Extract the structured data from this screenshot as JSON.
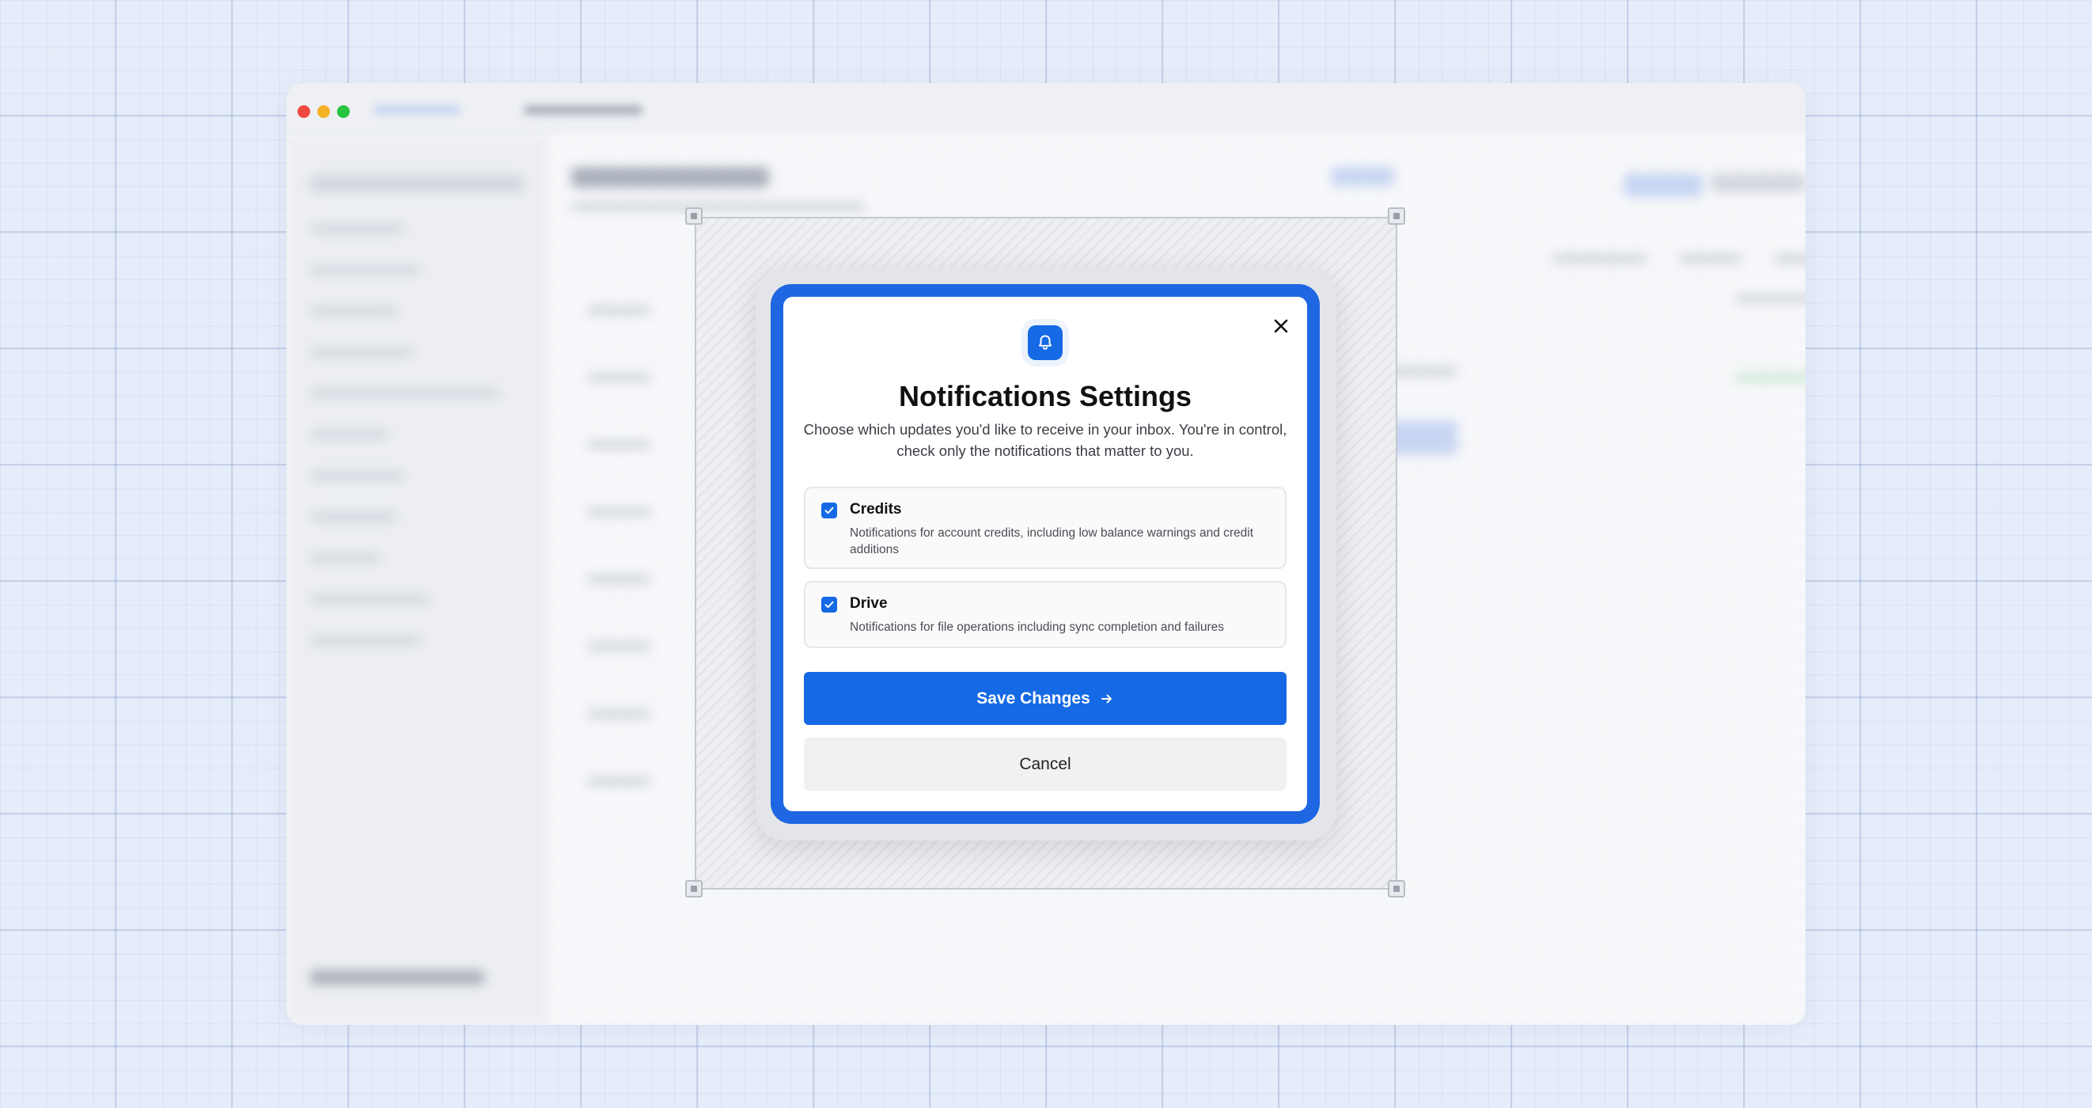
{
  "modal": {
    "title": "Notifications Settings",
    "subtitle": "Choose which updates you'd like to receive in your inbox. You're in control, check only the notifications that matter to you.",
    "options": [
      {
        "label": "Credits",
        "description": "Notifications for account credits, including low balance warnings and credit additions",
        "checked": true
      },
      {
        "label": "Drive",
        "description": "Notifications for file operations including sync completion and failures",
        "checked": true
      }
    ],
    "save_label": "Save Changes",
    "cancel_label": "Cancel"
  },
  "colors": {
    "accent": "#1569e4",
    "frame": "#1f67e2"
  },
  "icons": {
    "header": "bell-icon",
    "close": "close-icon",
    "save": "arrow-right-icon",
    "checkbox": "check-icon"
  }
}
